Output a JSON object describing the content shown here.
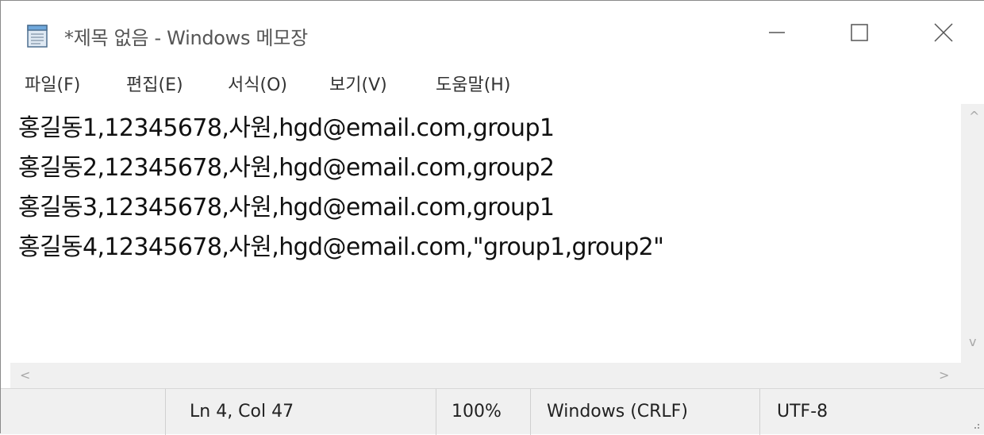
{
  "window": {
    "title": "*제목 없음 - Windows 메모장",
    "app_icon": "notepad-icon",
    "controls": {
      "minimize_icon": "minimize-icon",
      "maximize_icon": "maximize-icon",
      "close_icon": "close-icon"
    }
  },
  "menu": {
    "items": [
      {
        "label": "파일(F)"
      },
      {
        "label": "편집(E)"
      },
      {
        "label": "서식(O)"
      },
      {
        "label": "보기(V)"
      },
      {
        "label": "도움말(H)"
      }
    ]
  },
  "editor": {
    "lines": [
      "홍길동1,12345678,사원,hgd@email.com,group1",
      "홍길동2,12345678,사원,hgd@email.com,group2",
      "홍길동3,12345678,사원,hgd@email.com,group1",
      "홍길동4,12345678,사원,hgd@email.com,\"group1,group2\""
    ]
  },
  "scrollbars": {
    "up_arrow": "^",
    "down_arrow": "v",
    "left_arrow": "<",
    "right_arrow": ">"
  },
  "status": {
    "position": "Ln 4, Col 47",
    "zoom": "100%",
    "line_ending": "Windows (CRLF)",
    "encoding": "UTF-8"
  },
  "colors": {
    "background": "#ffffff",
    "chrome": "#f0f0f0",
    "text": "#111111"
  }
}
